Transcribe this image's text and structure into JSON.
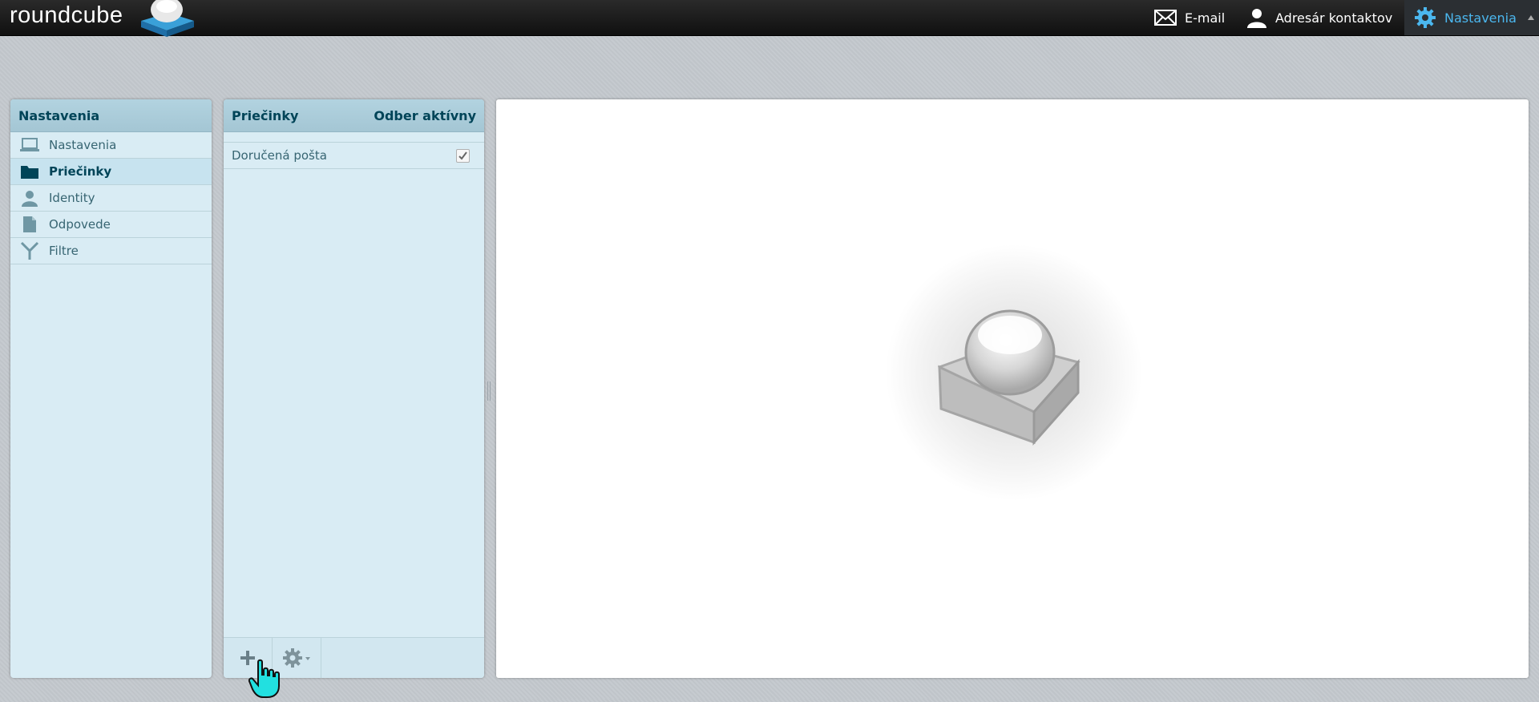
{
  "app": {
    "brand": "roundcube"
  },
  "topnav": {
    "email_label": "E-mail",
    "contacts_label": "Adresár kontaktov",
    "settings_label": "Nastavenia"
  },
  "settings_panel": {
    "title": "Nastavenia",
    "items": [
      {
        "label": "Nastavenia",
        "icon": "laptop-icon"
      },
      {
        "label": "Priečinky",
        "icon": "folder-icon",
        "selected": true
      },
      {
        "label": "Identity",
        "icon": "person-icon"
      },
      {
        "label": "Odpovede",
        "icon": "document-icon"
      },
      {
        "label": "Filtre",
        "icon": "filter-icon"
      }
    ]
  },
  "folders_panel": {
    "title": "Priečinky",
    "subscription_header": "Odber aktívny",
    "folders": [
      {
        "name": "Doručená pošta",
        "subscribed": true
      }
    ]
  },
  "colors": {
    "accent": "#4bb7ef",
    "panel_bg": "#d9ecf4",
    "header_bg": "#a4c6d4",
    "text_dark": "#004458"
  }
}
